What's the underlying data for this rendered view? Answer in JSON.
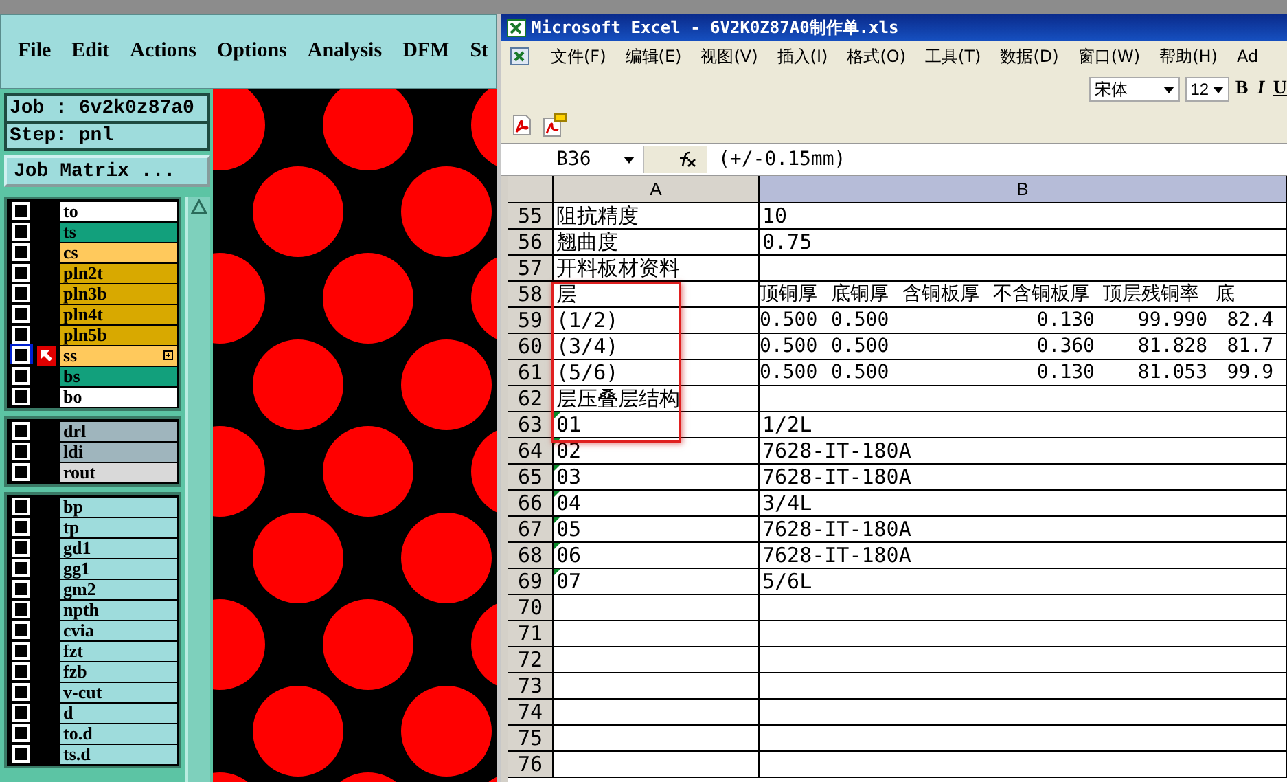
{
  "editor": {
    "menu": [
      "File",
      "Edit",
      "Actions",
      "Options",
      "Analysis",
      "DFM",
      "St"
    ],
    "job": "Job : 6v2k0z87a0",
    "step": "Step: pnl",
    "job_matrix_button": "Job Matrix ...",
    "layer_groups": [
      [
        {
          "name": "to",
          "color": "#ffffff",
          "checked": false,
          "selected": false
        },
        {
          "name": "ts",
          "color": "#12a07c",
          "checked": false,
          "selected": false
        },
        {
          "name": "cs",
          "color": "#ffc95c",
          "checked": false,
          "selected": false
        },
        {
          "name": "pln2t",
          "color": "#d8a900",
          "checked": false,
          "selected": false
        },
        {
          "name": "pln3b",
          "color": "#d8a900",
          "checked": false,
          "selected": false
        },
        {
          "name": "pln4t",
          "color": "#d8a900",
          "checked": false,
          "selected": false
        },
        {
          "name": "pln5b",
          "color": "#d8a900",
          "checked": false,
          "selected": false
        },
        {
          "name": "ss",
          "color": "#ffc95c",
          "checked": false,
          "selected": true
        },
        {
          "name": "bs",
          "color": "#12a07c",
          "checked": false,
          "selected": false
        },
        {
          "name": "bo",
          "color": "#ffffff",
          "checked": false,
          "selected": false
        }
      ],
      [
        {
          "name": "drl",
          "color": "#9fb5bd",
          "checked": false,
          "selected": false
        },
        {
          "name": "ldi",
          "color": "#9fb5bd",
          "checked": false,
          "selected": false
        },
        {
          "name": "rout",
          "color": "#d9d9d9",
          "checked": false,
          "selected": false
        }
      ],
      [
        {
          "name": "bp",
          "color": "#9edcdc",
          "checked": false,
          "selected": false
        },
        {
          "name": "tp",
          "color": "#9edcdc",
          "checked": false,
          "selected": false
        },
        {
          "name": "gd1",
          "color": "#9edcdc",
          "checked": false,
          "selected": false
        },
        {
          "name": "gg1",
          "color": "#9edcdc",
          "checked": false,
          "selected": false
        },
        {
          "name": "gm2",
          "color": "#9edcdc",
          "checked": false,
          "selected": false
        },
        {
          "name": "npth",
          "color": "#9edcdc",
          "checked": false,
          "selected": false
        },
        {
          "name": "cvia",
          "color": "#9edcdc",
          "checked": false,
          "selected": false
        },
        {
          "name": "fzt",
          "color": "#9edcdc",
          "checked": false,
          "selected": false
        },
        {
          "name": "fzb",
          "color": "#9edcdc",
          "checked": false,
          "selected": false
        },
        {
          "name": "v-cut",
          "color": "#9edcdc",
          "checked": false,
          "selected": false
        },
        {
          "name": "d",
          "color": "#9edcdc",
          "checked": false,
          "selected": false
        },
        {
          "name": "to.d",
          "color": "#9edcdc",
          "checked": false,
          "selected": false
        },
        {
          "name": "ts.d",
          "color": "#9edcdc",
          "checked": false,
          "selected": false
        }
      ]
    ]
  },
  "excel": {
    "title": "Microsoft Excel - 6V2K0Z87A0制作单.xls",
    "menu": [
      "文件(F)",
      "编辑(E)",
      "视图(V)",
      "插入(I)",
      "格式(O)",
      "工具(T)",
      "数据(D)",
      "窗口(W)",
      "帮助(H)",
      "Ad"
    ],
    "font_boxes": [
      "宋体",
      "12"
    ],
    "style_buttons": [
      "B",
      "I",
      "U"
    ],
    "name_box": "B36",
    "formula": "(+/-0.15mm)",
    "columns": [
      "A",
      "B"
    ],
    "rows": [
      {
        "number": "55",
        "a": "阻抗精度",
        "b": "10"
      },
      {
        "number": "56",
        "a": "翘曲度",
        "b": "0.75"
      },
      {
        "number": "57",
        "a": "开料板材资料"
      },
      {
        "number": "58",
        "a": "层",
        "b_cells": [
          "顶铜厚",
          "底铜厚",
          "含铜板厚",
          "不含铜板厚",
          "顶层残铜率",
          "底"
        ],
        "kind": "heading"
      },
      {
        "number": "59",
        "a": "(1/2)",
        "b_cells": [
          "0.500",
          "0.500",
          "0.130",
          "99.990",
          "82.4"
        ],
        "kind": "figures"
      },
      {
        "number": "60",
        "a": "(3/4)",
        "b_cells": [
          "0.500",
          "0.500",
          "0.360",
          "81.828",
          "81.7"
        ],
        "kind": "figures"
      },
      {
        "number": "61",
        "a": "(5/6)",
        "b_cells": [
          "0.500",
          "0.500",
          "0.130",
          "81.053",
          "99.9"
        ],
        "kind": "figures"
      },
      {
        "number": "62",
        "a": "层压叠层结构"
      },
      {
        "number": "63",
        "a": "01",
        "b": "1/2L",
        "flagged": true
      },
      {
        "number": "64",
        "a": "02",
        "b": "7628-IT-180A",
        "flagged": true
      },
      {
        "number": "65",
        "a": "03",
        "b": "7628-IT-180A",
        "flagged": true
      },
      {
        "number": "66",
        "a": "04",
        "b": "3/4L",
        "flagged": true
      },
      {
        "number": "67",
        "a": "05",
        "b": "7628-IT-180A",
        "flagged": true
      },
      {
        "number": "68",
        "a": "06",
        "b": "7628-IT-180A",
        "flagged": true
      },
      {
        "number": "69",
        "a": "07",
        "b": "5/6L",
        "flagged": true
      },
      {
        "number": "70"
      },
      {
        "number": "71"
      },
      {
        "number": "72"
      },
      {
        "number": "73"
      },
      {
        "number": "74"
      },
      {
        "number": "75"
      },
      {
        "number": "76"
      }
    ]
  }
}
